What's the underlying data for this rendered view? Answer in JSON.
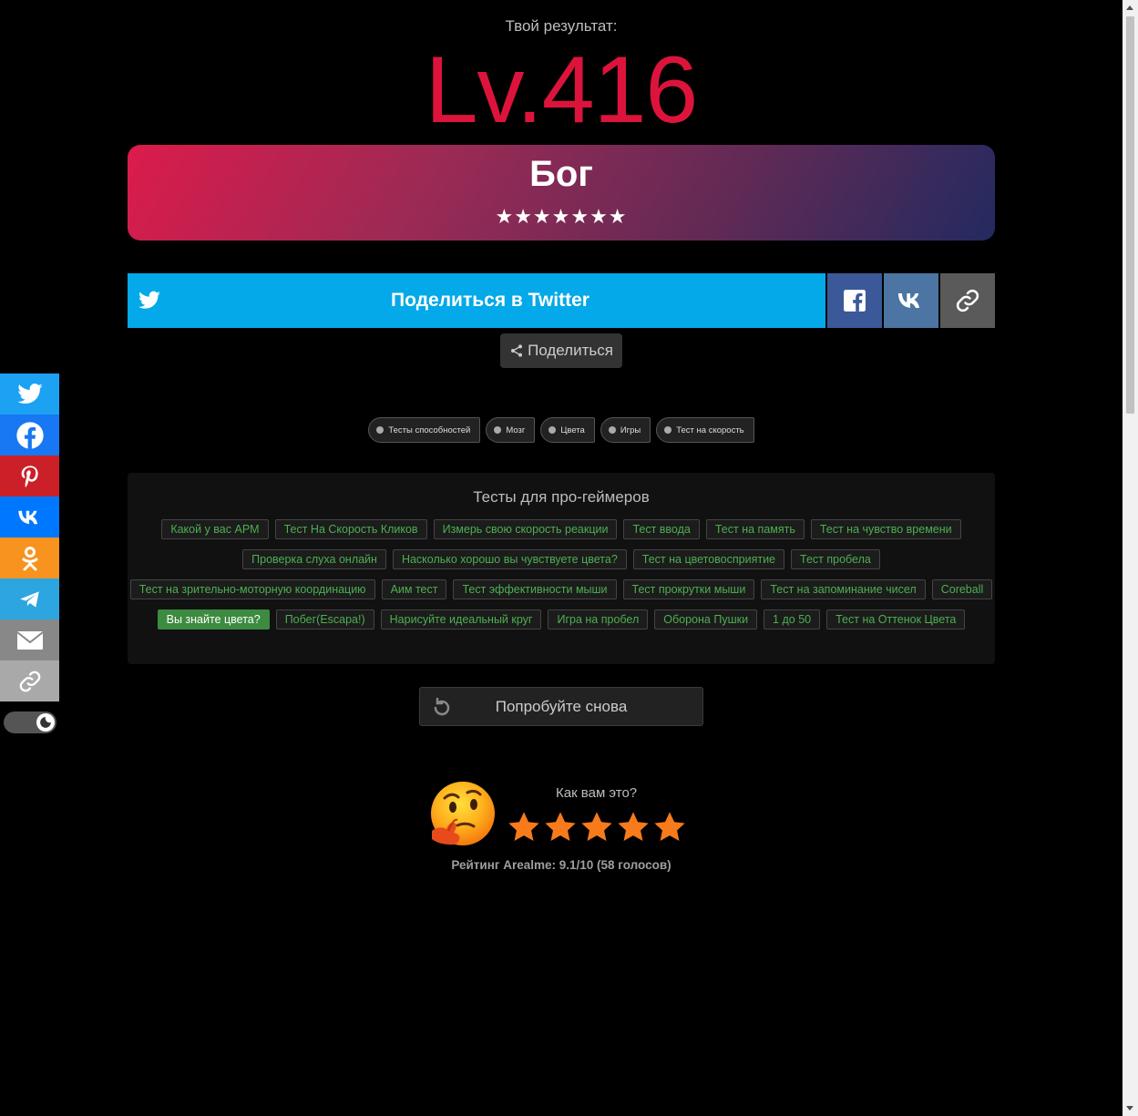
{
  "result": {
    "label": "Твой результат:",
    "level": "Lv.416"
  },
  "rank": {
    "title": "Бог",
    "stars": "★★★★★★★",
    "star_count": 7
  },
  "share": {
    "twitter_label": "Поделиться в Twitter",
    "share_label": "Поделиться",
    "colors": {
      "twitter": "#03a9e8",
      "facebook": "#3b5998",
      "vk": "#4c75a3",
      "link": "#5a5a5a"
    }
  },
  "tags": [
    "Тесты способностей",
    "Мозг",
    "Цвета",
    "Игры",
    "Тест на скорость"
  ],
  "pro_tests": {
    "title": "Тесты для про-геймеров",
    "rows": [
      [
        "Какой у вас APM",
        "Тест На Скорость Кликов",
        "Измерь свою скорость реакции",
        "Тест ввода",
        "Тест на память",
        "Тест на чувство времени"
      ],
      [
        "Проверка слуха онлайн",
        "Насколько хорошо вы чувствуете цвета?",
        "Тест на цветовосприятие",
        "Тест пробела"
      ],
      [
        "Тест на зрительно-моторную координацию",
        "Аим тест",
        "Тест эффективности мыши",
        "Тест прокрутки мыши",
        "Тест на запоминание чисел",
        "Coreball"
      ],
      [
        "Вы знайте цвета?",
        "Побег(Escapa!)",
        "Нарисуйте идеальный круг",
        "Игра на пробел",
        "Оборона Пушки",
        "1 до 50",
        "Тест на Оттенок Цвета"
      ]
    ],
    "active": "Вы знайте цвета?"
  },
  "retry": {
    "label": "Попробуйте снова"
  },
  "rating": {
    "question": "Как вам это?",
    "stars": 5,
    "summary": "Рейтинг Arealme: 9.1/10 (58 голосов)"
  },
  "side_share": [
    {
      "name": "twitter",
      "color": "#1da1f2"
    },
    {
      "name": "facebook",
      "color": "#1877f2"
    },
    {
      "name": "pinterest",
      "color": "#cb2027"
    },
    {
      "name": "vk",
      "color": "#0077ff"
    },
    {
      "name": "odnoklassniki",
      "color": "#f7931e"
    },
    {
      "name": "telegram",
      "color": "#2ca5e0"
    },
    {
      "name": "email",
      "color": "#888888"
    },
    {
      "name": "copy-link",
      "color": "#a9a9a9"
    }
  ]
}
